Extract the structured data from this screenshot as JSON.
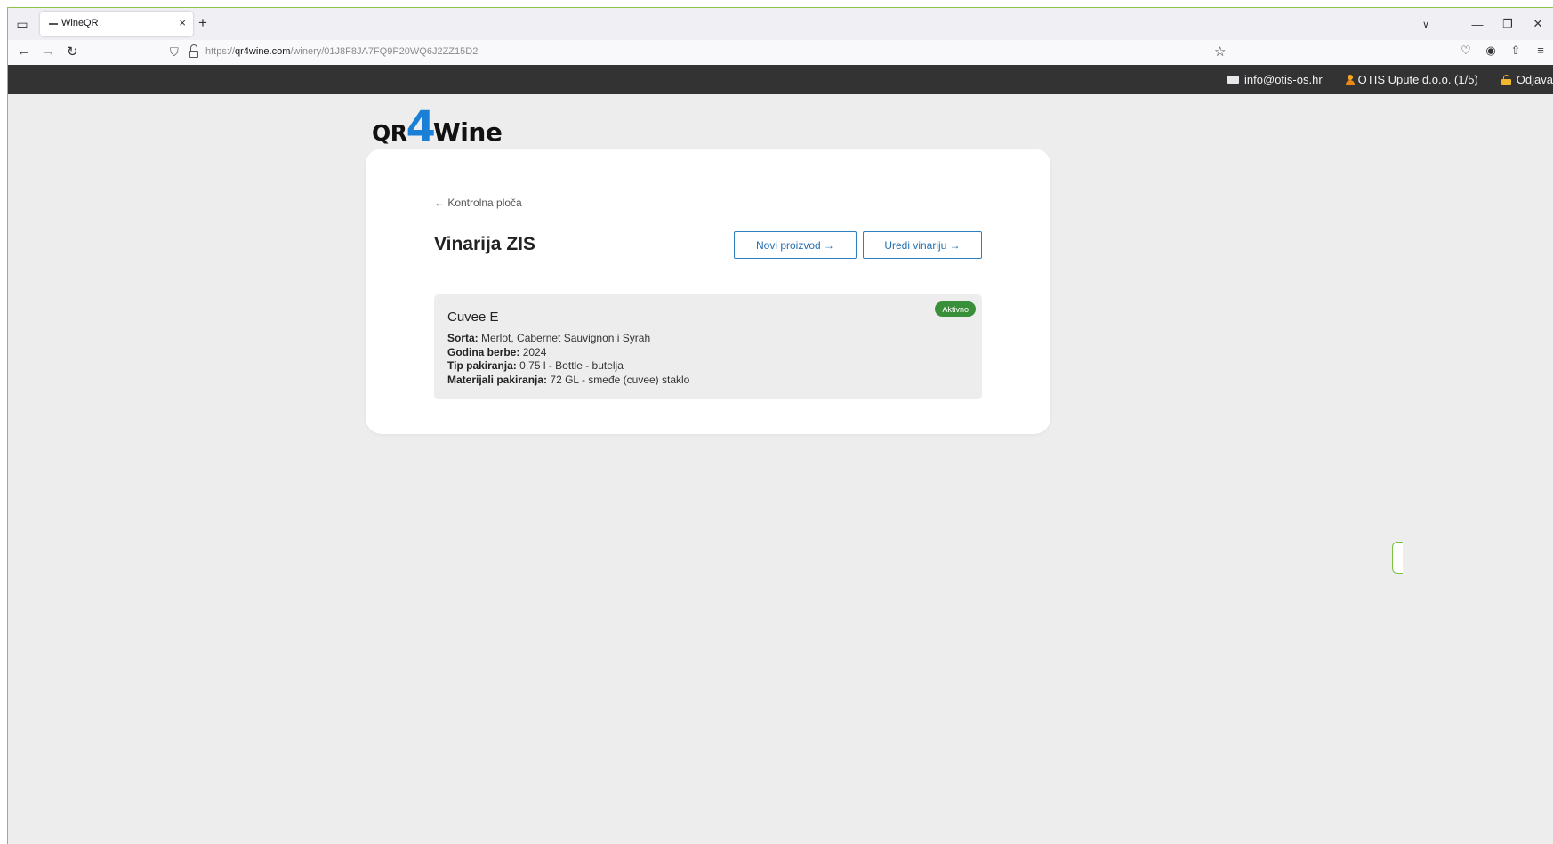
{
  "browser": {
    "tab_title": "WineQR",
    "tab_close": "×",
    "new_tab": "+",
    "url_prefix": "https://",
    "url_domain": "qr4wine.com",
    "url_path": "/winery/01J8F8JA7FQ9P20WQ6J2ZZ15D2",
    "icons": [
      "tab-list-icon",
      "back-icon",
      "forward-icon",
      "reload-icon",
      "shield-icon",
      "lock-icon",
      "star-icon",
      "pocket-icon",
      "account-icon",
      "extensions-icon",
      "menu-icon",
      "minimize-icon",
      "restore-icon",
      "close-icon"
    ]
  },
  "topbar": {
    "email": "info@otis-os.hr",
    "company": "OTIS Upute d.o.o. (1/5)",
    "logout": "Odjava"
  },
  "logo": {
    "qr": "QR",
    "four": "4",
    "wine": "Wine"
  },
  "page": {
    "back_link": "← Kontrolna ploča",
    "title": "Vinarija ZIS",
    "new_product_button": "Novi proizvod →",
    "edit_winery_button": "Uredi vinariju →"
  },
  "products": [
    {
      "name": "Cuvee E",
      "status": "Aktivno",
      "variety_label": "Sorta:",
      "variety": "Merlot, Cabernet Sauvignon i Syrah",
      "vintage_label": "Godina berbe:",
      "vintage": "2024",
      "package_label": "Tip pakiranja:",
      "package": "0,75 l - Bottle - butelja",
      "materials_label": "Materijali pakiranja:",
      "materials": "72 GL - smeđe (cuvee) staklo"
    }
  ],
  "colors": {
    "accent": "#2f7fc1",
    "logo_blue": "#1a7fd6",
    "active_badge": "#3a8f3a",
    "topbar": "#333333"
  }
}
